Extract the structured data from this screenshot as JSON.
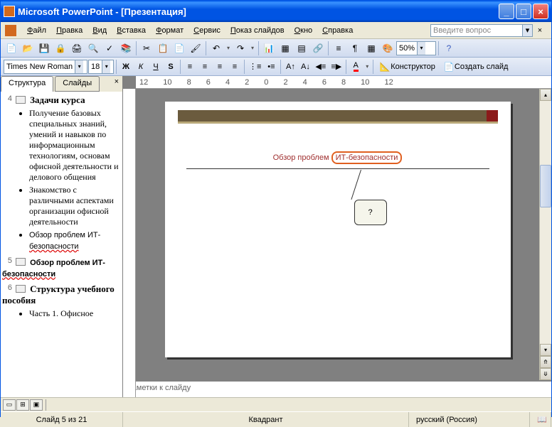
{
  "window": {
    "title": "Microsoft PowerPoint - [Презентация]"
  },
  "menu": {
    "file": "Файл",
    "edit": "Правка",
    "view": "Вид",
    "insert": "Вставка",
    "format": "Формат",
    "tools": "Сервис",
    "slideshow": "Показ слайдов",
    "window": "Окно",
    "help": "Справка",
    "ask_placeholder": "Введите вопрос"
  },
  "toolbar": {
    "font": "Times New Roman",
    "size": "18",
    "zoom": "50%",
    "designer": "Конструктор",
    "newslide": "Создать слайд"
  },
  "tabs": {
    "structure": "Структура",
    "slides": "Слайды"
  },
  "outline": {
    "s4": {
      "num": "4",
      "title": "Задачи курса",
      "b1": "Получение базовых специальных знаний, умений и навыков по информационным технологиям, основам офисной деятельности и делового общения",
      "b2": "Знакомство с различными аспектами организации офисной деятельности",
      "b3_a": "Обзор проблем ИТ-",
      "b3_b": "безопасности"
    },
    "s5": {
      "num": "5",
      "title_a": "Обзор проблем ИТ-",
      "title_b": "безопасности"
    },
    "s6": {
      "num": "6",
      "title": "Структура учебного пособия",
      "b1": "Часть 1. Офисное"
    }
  },
  "slide": {
    "title_a": "Обзор проблем ",
    "title_b": "ИТ-безопасности",
    "callout": "?"
  },
  "ruler": "12 10 8 6 4 2 0 2 4 6 8 10 12",
  "notes": {
    "label": "Заметки к слайду"
  },
  "status": {
    "slide": "Слайд 5 из 21",
    "template": "Квадрант",
    "lang": "русский (Россия)"
  }
}
